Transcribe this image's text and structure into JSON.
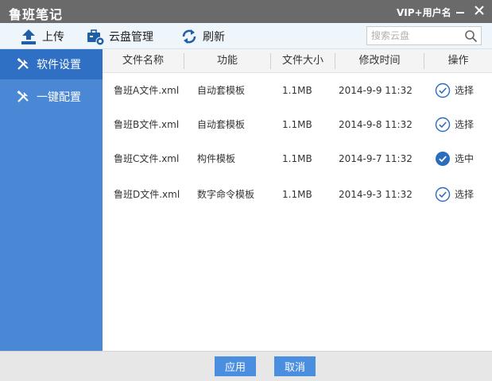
{
  "window": {
    "title": "鲁班笔记",
    "user_label": "VIP+用户名"
  },
  "toolbar": {
    "upload_label": "上传",
    "cloud_label": "云盘管理",
    "refresh_label": "刷新",
    "search_placeholder": "搜索云盘"
  },
  "sidebar": {
    "items": [
      {
        "label": "软件设置",
        "icon": "tools-icon",
        "active": true
      },
      {
        "label": "一键配置",
        "icon": "tools-icon",
        "active": false
      }
    ]
  },
  "table": {
    "columns": [
      "文件名称",
      "功能",
      "文件大小",
      "修改时间",
      "操作"
    ],
    "rows": [
      {
        "name": "鲁班A文件.xml",
        "function": "自动套模板",
        "size": "1.1MB",
        "time": "2014-9-9 11:32",
        "action": "选择",
        "selected": false
      },
      {
        "name": "鲁班B文件.xml",
        "function": "自动套模板",
        "size": "1.1MB",
        "time": "2014-9-8 11:32",
        "action": "选择",
        "selected": false
      },
      {
        "name": "鲁班C文件.xml",
        "function": "构件模板",
        "size": "1.1MB",
        "time": "2014-9-7 11:32",
        "action": "选中",
        "selected": true
      },
      {
        "name": "鲁班D文件.xml",
        "function": "数字命令模板",
        "size": "1.1MB",
        "time": "2014-9-3 11:32",
        "action": "选择",
        "selected": false
      }
    ]
  },
  "footer": {
    "apply_label": "应用",
    "cancel_label": "取消"
  },
  "colors": {
    "titlebar": "#6a6a6a",
    "sidebar": "#4a87d5",
    "sidebar_active": "#2f6fc4",
    "accent": "#2a6dbf",
    "button": "#4a8ee0"
  }
}
